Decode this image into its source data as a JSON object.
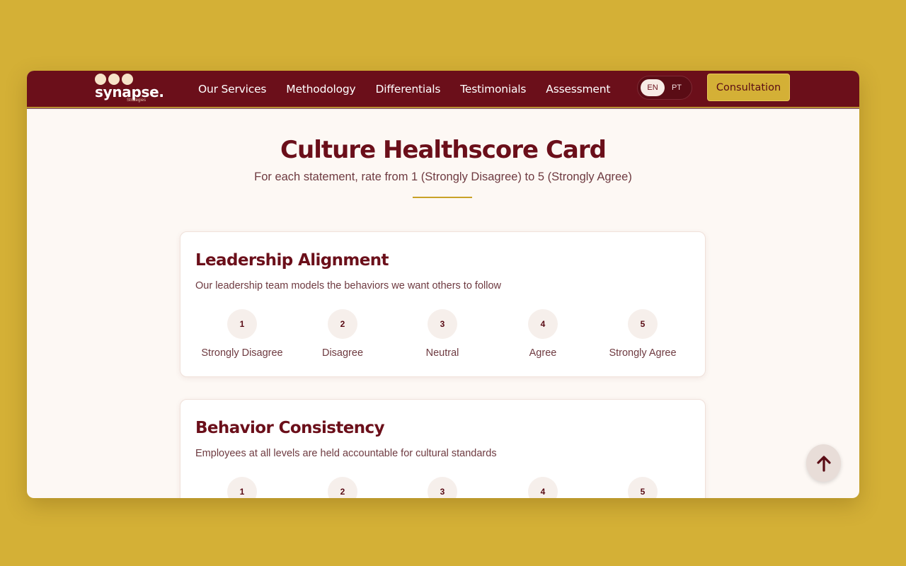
{
  "brand": {
    "name": "synapse.",
    "tagline": "Strategies"
  },
  "nav": {
    "links": [
      "Our Services",
      "Methodology",
      "Differentials",
      "Testimonials",
      "Assessment"
    ],
    "languages": [
      "EN",
      "PT"
    ],
    "active_language": "EN",
    "cta_label": "Consultation"
  },
  "page": {
    "title": "Culture Healthscore Card",
    "subtitle": "For each statement, rate from 1 (Strongly Disagree) to 5 (Strongly Agree)"
  },
  "scale": {
    "values": [
      "1",
      "2",
      "3",
      "4",
      "5"
    ],
    "labels": [
      "Strongly Disagree",
      "Disagree",
      "Neutral",
      "Agree",
      "Strongly Agree"
    ]
  },
  "questions": [
    {
      "title": "Leadership Alignment",
      "statement": "Our leadership team models the behaviors we want others to follow"
    },
    {
      "title": "Behavior Consistency",
      "statement": "Employees at all levels are held accountable for cultural standards"
    }
  ],
  "icons": {
    "back_to_top": "arrow-up-icon"
  },
  "colors": {
    "background": "#d4b036",
    "brand_primary": "#6b0f1a",
    "accent": "#c9a227",
    "surface": "#fdf8f4"
  }
}
